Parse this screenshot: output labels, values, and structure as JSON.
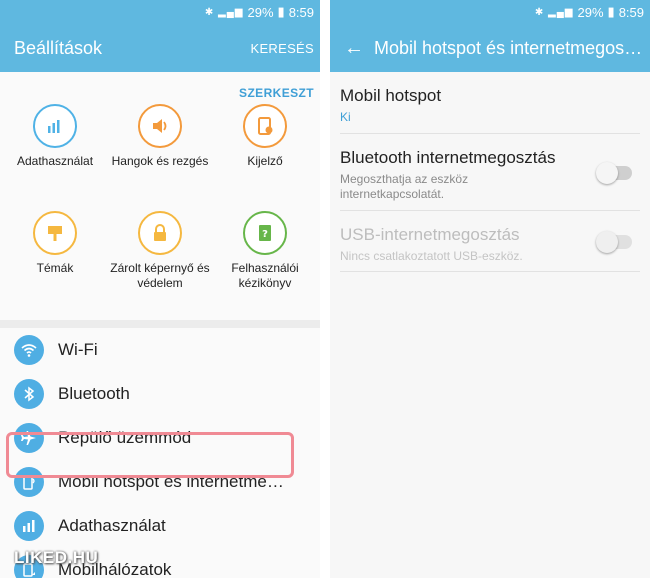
{
  "status": {
    "battery": "29%",
    "time": "8:59"
  },
  "left": {
    "title": "Beállítások",
    "search": "KERESÉS",
    "edit": "SZERKESZT",
    "quick": [
      {
        "label": "Adathasználat",
        "icon": "data-usage-icon",
        "color": "#4fb2e6"
      },
      {
        "label": "Hangok és rezgés",
        "icon": "sound-icon",
        "color": "#f39a3c"
      },
      {
        "label": "Kijelző",
        "icon": "display-icon",
        "color": "#f39a3c"
      },
      {
        "label": "Témák",
        "icon": "themes-icon",
        "color": "#f5b840"
      },
      {
        "label": "Zárolt képernyő és védelem",
        "icon": "lock-icon",
        "color": "#f5b840"
      },
      {
        "label": "Felhasználói kézikönyv",
        "icon": "help-book-icon",
        "color": "#67b64a"
      }
    ],
    "list": [
      {
        "label": "Wi-Fi",
        "icon": "wifi-icon"
      },
      {
        "label": "Bluetooth",
        "icon": "bluetooth-icon"
      },
      {
        "label": "Repülő üzemmód",
        "icon": "airplane-icon"
      },
      {
        "label": "Mobil hotspot és internetmegosztás",
        "icon": "hotspot-icon"
      },
      {
        "label": "Adathasználat",
        "icon": "data-usage-icon"
      },
      {
        "label": "Mobilhálózatok",
        "icon": "mobile-network-icon"
      }
    ],
    "watermark": "LIKED.HU"
  },
  "right": {
    "title": "Mobil hotspot és internetmegosztás",
    "rows": [
      {
        "title": "Mobil hotspot",
        "subtitle": "Ki"
      },
      {
        "title": "Bluetooth internetmegosztás",
        "subtitle": "Megoszthatja az eszköz internetkapcsolatát.",
        "toggle": "off"
      },
      {
        "title": "USB-internetmegosztás",
        "subtitle": "Nincs csatlakoztatott USB-eszköz.",
        "toggle": "off",
        "disabled": true
      }
    ]
  },
  "colors": {
    "header": "#5fb8e0",
    "accent": "#3f9fd6",
    "highlight": "#f08a94"
  }
}
